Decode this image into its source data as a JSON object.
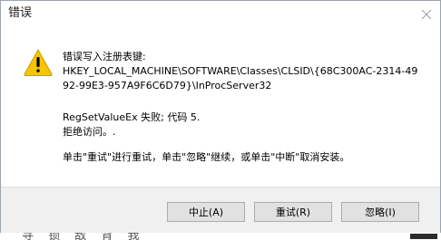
{
  "window": {
    "title": "错误"
  },
  "message": {
    "line1": "错误写入注册表键:",
    "line2": "HKEY_LOCAL_MACHINE\\SOFTWARE\\Classes\\CLSID\\{68C300AC-2314-49",
    "line3": "92-99E3-957A9F6C6D79}\\InProcServer32",
    "line4": "RegSetValueEx 失败; 代码 5.",
    "line5": "拒绝访问。.",
    "line6": "单击\"重试\"进行重试，单击\"忽略\"继续，或单击\"中断\"取消安装。"
  },
  "buttons": {
    "abort": "中止(A)",
    "retry": "重试(R)",
    "ignore": "忽略(I)"
  },
  "background_fragment": "寻 锁 敌 背 我",
  "colors": {
    "warning_fill": "#f7c600",
    "warning_mark": "#000000",
    "footer_bg": "#f0f0f0",
    "button_bg": "#e1e1e1",
    "button_border": "#adadad"
  },
  "icons": {
    "warning": "warning-triangle-icon",
    "close": "close-icon"
  }
}
